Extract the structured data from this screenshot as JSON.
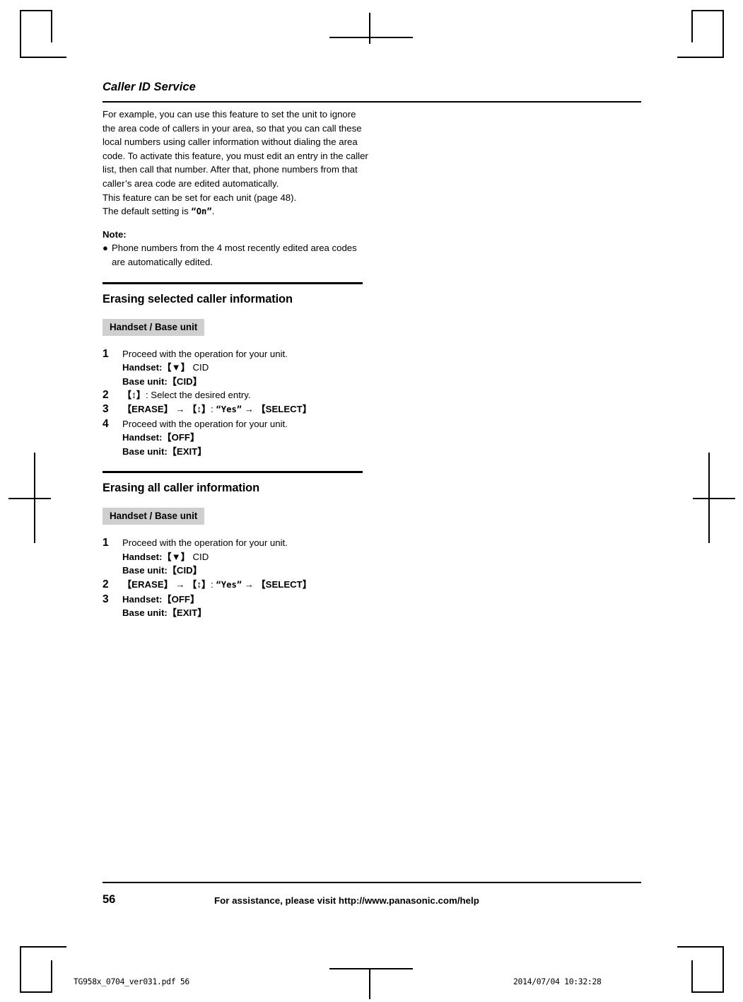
{
  "header": {
    "chapter_title": "Caller ID Service"
  },
  "intro": {
    "paragraph": "For example, you can use this feature to set the unit to ignore the area code of callers in your area, so that you can call these local numbers using caller information without dialing the area code. To activate this feature, you must edit an entry in the caller list, then call that number. After that, phone numbers from that caller’s area code are edited automatically.",
    "paragraph2_prefix": "This feature can be set for each unit (page 48).",
    "paragraph3_prefix": "The default setting is ",
    "paragraph3_value": "“On”",
    "paragraph3_suffix": "."
  },
  "note": {
    "label": "Note:",
    "bullet": "●",
    "text": "Phone numbers from the 4 most recently edited area codes are automatically edited."
  },
  "sections": [
    {
      "heading": "Erasing selected caller information",
      "unit_tag": "Handset / Base unit",
      "steps": [
        {
          "num": "1",
          "line1": "Proceed with the operation for your unit.",
          "line2_label": "Handset:",
          "line2_key": "【▼】",
          "line2_rest": " CID",
          "line3_label": "Base unit:",
          "line3_key": "【CID】"
        },
        {
          "num": "2",
          "key": "【↕】",
          "rest": ": Select the desired entry."
        },
        {
          "num": "3",
          "key1": "【ERASE】",
          "arrow1": "→",
          "key2": "【↕】",
          "mid": ": ",
          "quoted": "“Yes”",
          "arrow2": "→",
          "key3": "【SELECT】"
        },
        {
          "num": "4",
          "line1": "Proceed with the operation for your unit.",
          "line2_label": "Handset:",
          "line2_key": "【OFF】",
          "line3_label": "Base unit:",
          "line3_key": "【EXIT】"
        }
      ]
    },
    {
      "heading": "Erasing all caller information",
      "unit_tag": "Handset / Base unit",
      "steps": [
        {
          "num": "1",
          "line1": "Proceed with the operation for your unit.",
          "line2_label": "Handset:",
          "line2_key": "【▼】",
          "line2_rest": " CID",
          "line3_label": "Base unit:",
          "line3_key": "【CID】"
        },
        {
          "num": "2",
          "key1": "【ERASE】",
          "arrow1": "→",
          "key2": "【↕】",
          "mid": ": ",
          "quoted": "“Yes”",
          "arrow2": "→",
          "key3": "【SELECT】"
        },
        {
          "num": "3",
          "line2_label": "Handset:",
          "line2_key": "【OFF】",
          "line3_label": "Base unit:",
          "line3_key": "【EXIT】"
        }
      ]
    }
  ],
  "footer": {
    "page_number": "56",
    "assistance_text": "For assistance, please visit http://www.panasonic.com/help"
  },
  "slug": {
    "left": "TG958x_0704_ver031.pdf    56",
    "right": "2014/07/04   10:32:28"
  }
}
